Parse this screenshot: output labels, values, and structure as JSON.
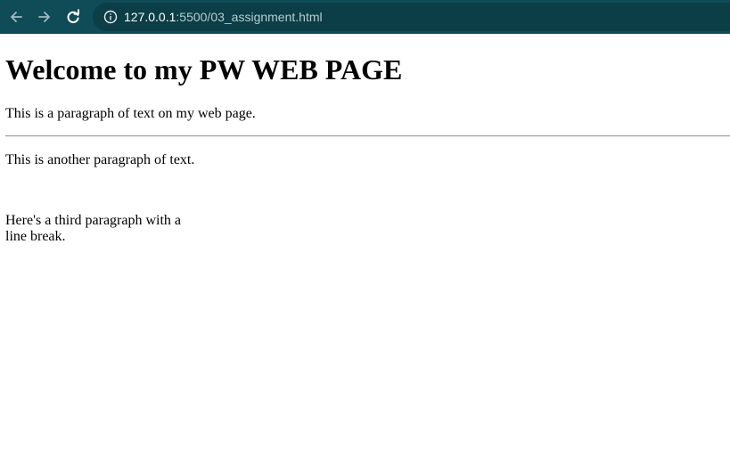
{
  "browser": {
    "url_host": "127.0.0.1",
    "url_rest": ":5500/03_assignment.html",
    "icons": {
      "back": "arrow-left-icon",
      "forward": "arrow-right-icon",
      "reload": "reload-icon",
      "site_info": "info-icon"
    },
    "colors": {
      "toolbar": "#0f4c57",
      "omnibox": "#0b3e47"
    }
  },
  "page": {
    "heading": "Welcome to my PW WEB PAGE",
    "paragraph_1": "This is a paragraph of text on my web page.",
    "paragraph_2": "This is another paragraph of text.",
    "paragraph_3_line_1": "Here's a third paragraph with a",
    "paragraph_3_line_2": "line break."
  }
}
